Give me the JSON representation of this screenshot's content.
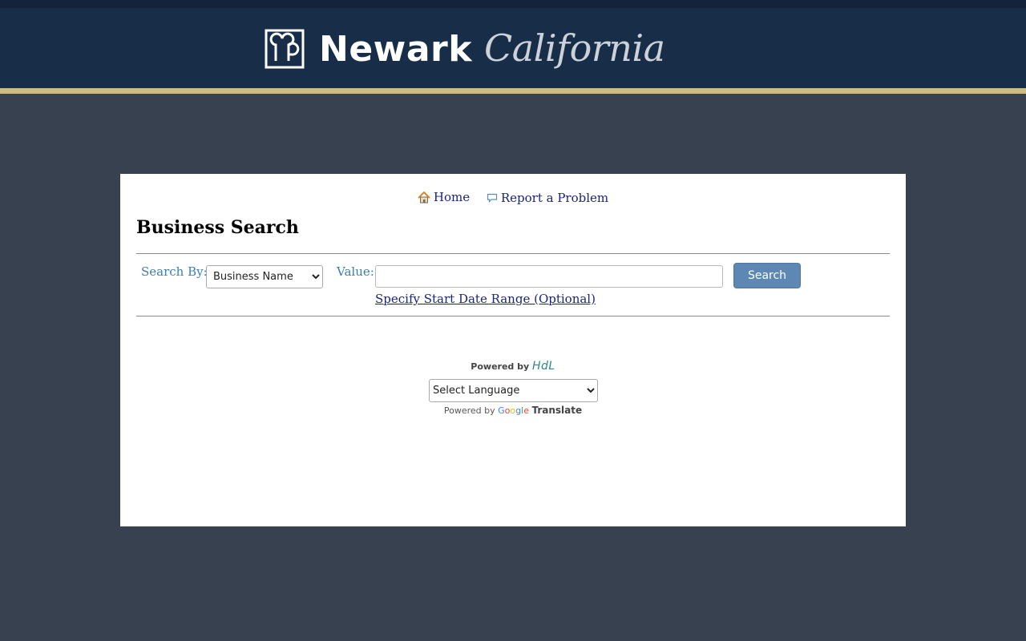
{
  "brand": {
    "name": "Newark",
    "script": "California",
    "colors": {
      "banner": "#182d48",
      "accent_bar": "#cdb98b",
      "page_bg": "#374150"
    }
  },
  "nav": {
    "home_label": "Home",
    "home_icon": "home-icon",
    "report_label": "Report a Problem",
    "report_icon": "speech-bubble-icon"
  },
  "page": {
    "title": "Business Search"
  },
  "search": {
    "by_label": "Search By:",
    "by_selected": "Business Name",
    "value_label": "Value:",
    "value": "",
    "button_label": "Search",
    "date_link": "Specify Start Date Range (Optional)",
    "button_color": "#5d88b4"
  },
  "footer": {
    "powered_by_text": "Powered by",
    "powered_by_logo": "HdL",
    "language_selected": "Select Language",
    "google_prefix": "Powered by",
    "google_word": "Google",
    "translate_label": "Translate"
  }
}
